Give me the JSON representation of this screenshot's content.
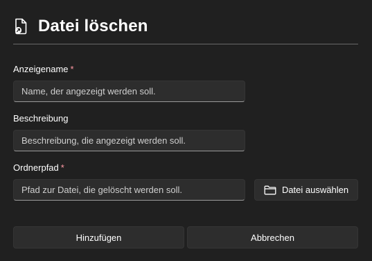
{
  "dialog": {
    "title": "Datei löschen",
    "title_icon": "file-delete-icon"
  },
  "fields": {
    "display_name": {
      "label": "Anzeigename",
      "required_marker": "*",
      "value": "",
      "placeholder": "Name, der angezeigt werden soll."
    },
    "description": {
      "label": "Beschreibung",
      "value": "",
      "placeholder": "Beschreibung, die angezeigt werden soll."
    },
    "folder_path": {
      "label": "Ordnerpfad",
      "required_marker": "*",
      "value": "",
      "placeholder": "Pfad zur Datei, die gelöscht werden soll.",
      "browse_label": "Datei auswählen",
      "browse_icon": "folder-icon"
    }
  },
  "actions": {
    "add_label": "Hinzufügen",
    "cancel_label": "Abbrechen"
  },
  "colors": {
    "background": "#202020",
    "control": "#2d2d2d",
    "required": "#ff99a4"
  }
}
